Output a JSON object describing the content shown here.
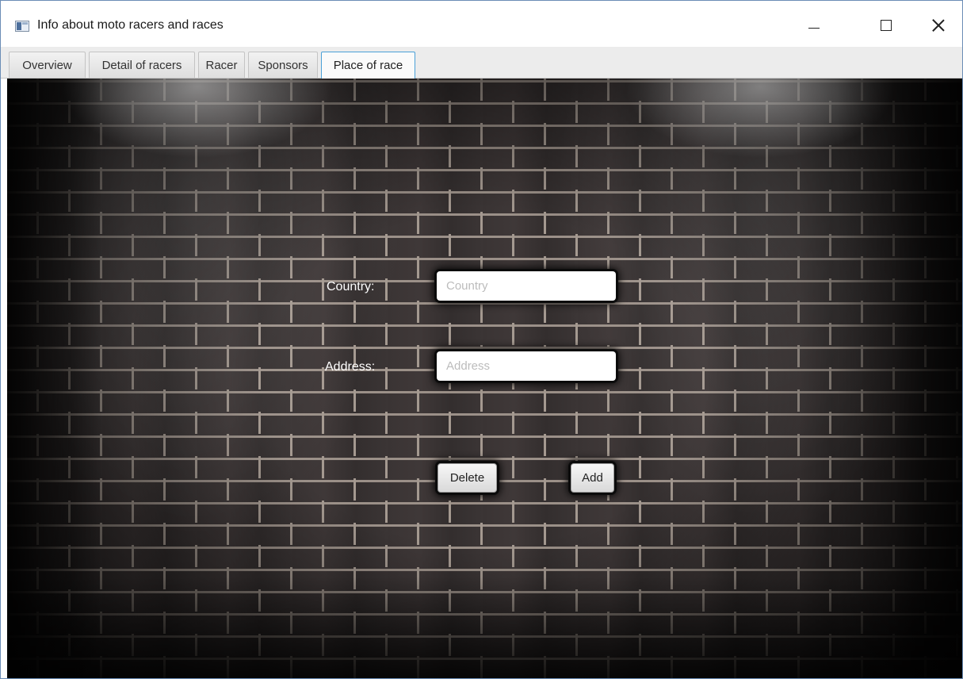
{
  "window": {
    "title": "Info about moto racers and races",
    "controls": {
      "minimize_icon": "minimize-icon",
      "maximize_icon": "maximize-icon",
      "close_icon": "close-icon"
    }
  },
  "tabs": [
    {
      "label": "Overview",
      "active": false
    },
    {
      "label": "Detail of racers",
      "active": false
    },
    {
      "label": "Racer",
      "active": false
    },
    {
      "label": "Sponsors",
      "active": false
    },
    {
      "label": "Place of race",
      "active": true
    }
  ],
  "form": {
    "country": {
      "label": "Country:",
      "value": "",
      "placeholder": "Country"
    },
    "address": {
      "label": "Address:",
      "value": "",
      "placeholder": "Address"
    },
    "delete_label": "Delete",
    "add_label": "Add"
  },
  "colors": {
    "active_tab_border": "#4aa0d8",
    "wall_mortar": "#9b9088",
    "wall_brick": "#3a3434"
  }
}
